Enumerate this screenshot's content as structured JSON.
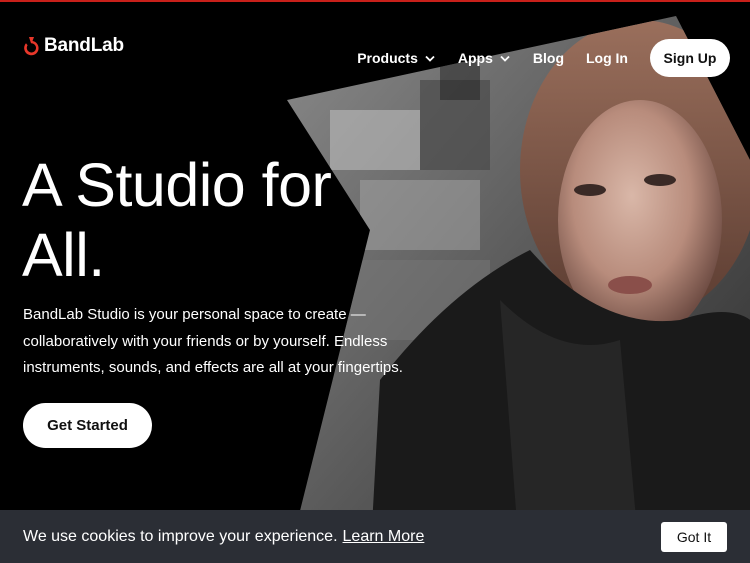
{
  "brand": {
    "name": "BandLab",
    "accent": "#c8201a",
    "logo_icon": "bandlab-logo-icon"
  },
  "nav": {
    "products": "Products",
    "apps": "Apps",
    "blog": "Blog",
    "login": "Log In",
    "signup": "Sign Up",
    "chevron_icon": "chevron-down-icon"
  },
  "hero": {
    "title_line1": "A Studio for",
    "title_line2": "All.",
    "description": "BandLab Studio is your personal space to create — collaboratively with your friends or by yourself. Endless instruments, sounds, and effects are all at your fingertips.",
    "cta": "Get Started",
    "image": "woman-portrait-photo"
  },
  "cookie": {
    "message": "We use cookies to improve your experience.",
    "link": "Learn More",
    "button": "Got It",
    "background": "#2b2e35"
  }
}
